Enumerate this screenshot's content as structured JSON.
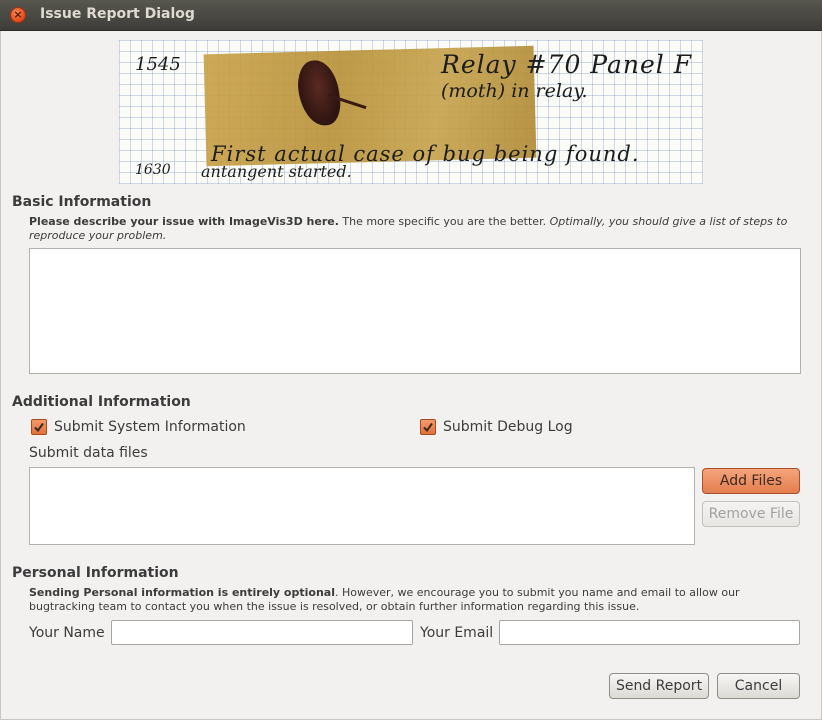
{
  "window": {
    "title": "Issue Report Dialog",
    "close_glyph": "×"
  },
  "image": {
    "notes": {
      "time": "1545",
      "line1": "Relay #70 Panel F",
      "line2": "(moth) in relay.",
      "line3": "First actual case of bug being found.",
      "line4a": "1630",
      "line4b": "antangent started."
    }
  },
  "basic": {
    "heading": "Basic Information",
    "desc_bold": "Please describe your issue with ImageVis3D here.",
    "desc_normal": " The more specific you are the better. ",
    "desc_italic": "Optimally, you should give a list of steps to reproduce your problem.",
    "issue_text": ""
  },
  "additional": {
    "heading": "Additional Information",
    "submit_system_info": {
      "label": "Submit System Information",
      "checked": true
    },
    "submit_debug_log": {
      "label": "Submit Debug Log",
      "checked": true
    },
    "files_label": "Submit data files",
    "add_files_label": "Add Files",
    "remove_file_label": "Remove File",
    "files": []
  },
  "personal": {
    "heading": "Personal Information",
    "desc_bold": "Sending Personal information is entirely optional",
    "desc_normal": ".  However, we encourage you to submit you name and email to allow our bugtracking team to contact you when the issue is resolved, or obtain further information regarding this issue.",
    "name_label": "Your Name",
    "name_value": "",
    "email_label": "Your Email",
    "email_value": ""
  },
  "footer": {
    "send_label": "Send Report",
    "cancel_label": "Cancel"
  },
  "colors": {
    "accent": "#e47e4f",
    "titlebar": "#3e3d39",
    "background": "#f2f1f0"
  }
}
